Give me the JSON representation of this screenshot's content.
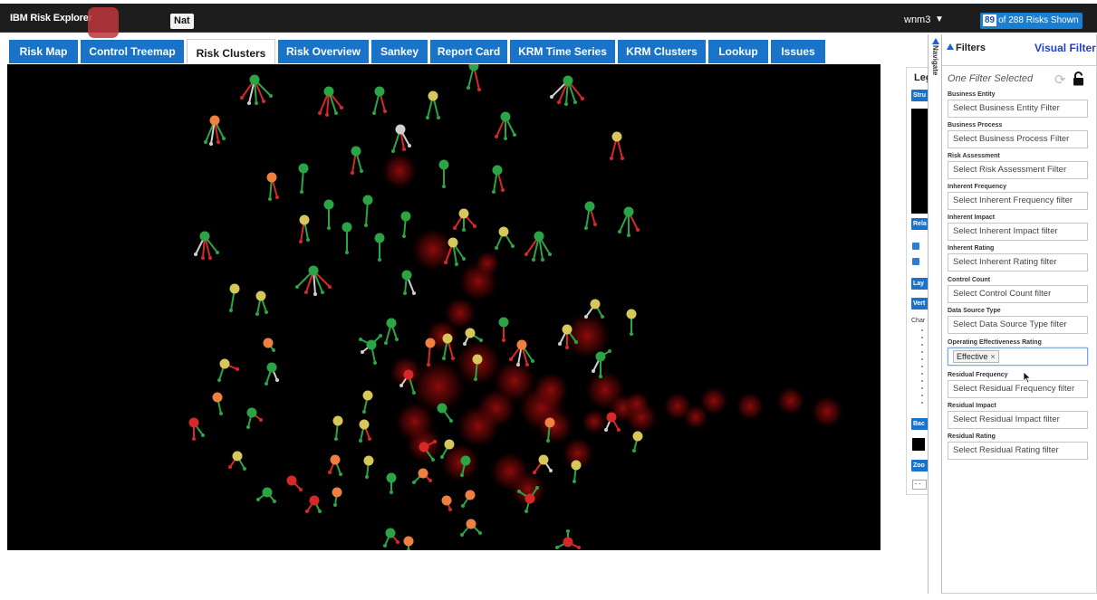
{
  "app": {
    "title": "IBM Risk Explorer",
    "nat_button": "Nat"
  },
  "user": {
    "name": "wnm3"
  },
  "risks_shown": {
    "count": "89",
    "label": "of 288 Risks Shown"
  },
  "tabs": [
    {
      "label": "Risk Map",
      "active": false
    },
    {
      "label": "Control Treemap",
      "active": false
    },
    {
      "label": "Risk Clusters",
      "active": true
    },
    {
      "label": "Risk Overview",
      "active": false
    },
    {
      "label": "Sankey",
      "active": false
    },
    {
      "label": "Report Card",
      "active": false
    },
    {
      "label": "KRM Time Series",
      "active": false
    },
    {
      "label": "KRM Clusters",
      "active": false
    },
    {
      "label": "Lookup",
      "active": false
    },
    {
      "label": "Issues",
      "active": false
    }
  ],
  "legend_panel": {
    "title": "Leg",
    "buttons": [
      "Stru",
      "Rela",
      "Lay",
      "Vert",
      "Bac",
      "Zoo"
    ],
    "char_label": "Char",
    "zoom_select": "- -"
  },
  "navigate": {
    "label": "Navigate"
  },
  "filters": {
    "title": "Filters",
    "visual_filter_link": "Visual Filter",
    "summary": "One Filter Selected",
    "items": [
      {
        "label": "Business Entity",
        "placeholder": "Select Business Entity Filter"
      },
      {
        "label": "Business Process",
        "placeholder": "Select Business Process Filter"
      },
      {
        "label": "Risk Assessment",
        "placeholder": "Select Risk Assessment Filter"
      },
      {
        "label": "Inherent Frequency",
        "placeholder": "Select Inherent Frequency filter"
      },
      {
        "label": "Inherent Impact",
        "placeholder": "Select Inherent Impact filter"
      },
      {
        "label": "Inherent Rating",
        "placeholder": "Select Inherent Rating filter"
      },
      {
        "label": "Control Count",
        "placeholder": "Select Control Count filter"
      },
      {
        "label": "Data Source Type",
        "placeholder": "Select Data Source Type filter"
      },
      {
        "label": "Operating Effectiveness Rating",
        "placeholder": "",
        "tag": "Effective"
      },
      {
        "label": "Residual Frequency",
        "placeholder": "Select Residual Frequency filter"
      },
      {
        "label": "Residual Impact",
        "placeholder": "Select Residual Impact filter"
      },
      {
        "label": "Residual Rating",
        "placeholder": "Select Residual Rating filter"
      }
    ]
  },
  "colors": {
    "brand_blue": "#1973c8",
    "top_bar": "#1d1d1d",
    "node_green": "#2aa444",
    "node_red": "#d62828",
    "node_orange": "#f08040",
    "glow_red": "#8a0a0a"
  }
}
